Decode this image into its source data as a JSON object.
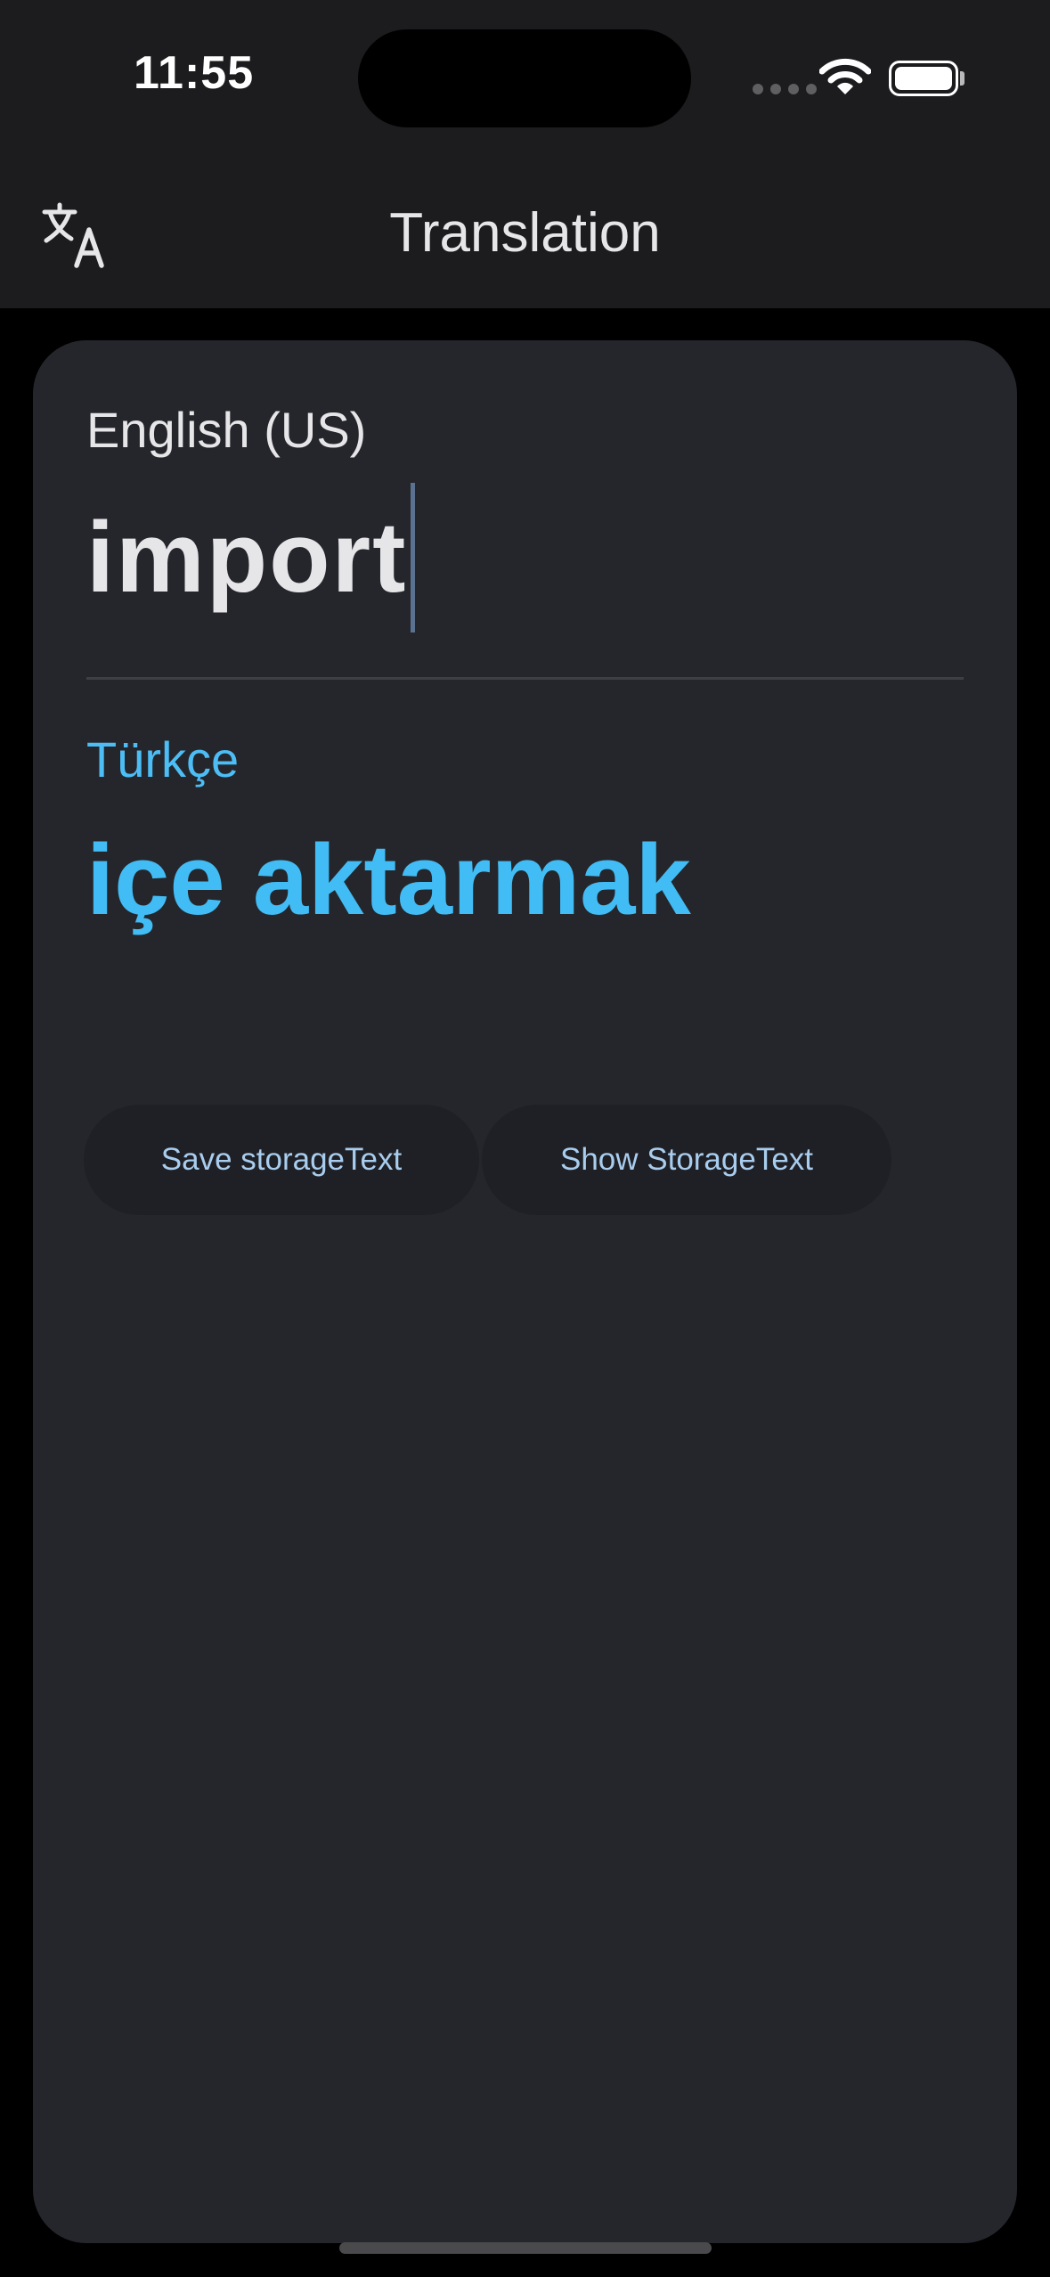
{
  "status_bar": {
    "time": "11:55",
    "icons": [
      "cellular-signal-icon",
      "wifi-icon",
      "battery-icon"
    ]
  },
  "app_bar": {
    "title": "Translation",
    "leading_icon": "translate-icon"
  },
  "translator": {
    "source_language": "English (US)",
    "source_text": "import",
    "target_language": "Türkçe",
    "target_text": "içe aktarmak"
  },
  "actions": {
    "save_label": "Save storageText",
    "show_label": "Show StorageText"
  },
  "colors": {
    "background": "#000000",
    "app_bar": "#1c1c1e",
    "card": "#25262b",
    "accent": "#42bcf5",
    "button_text": "#a9cdee"
  }
}
